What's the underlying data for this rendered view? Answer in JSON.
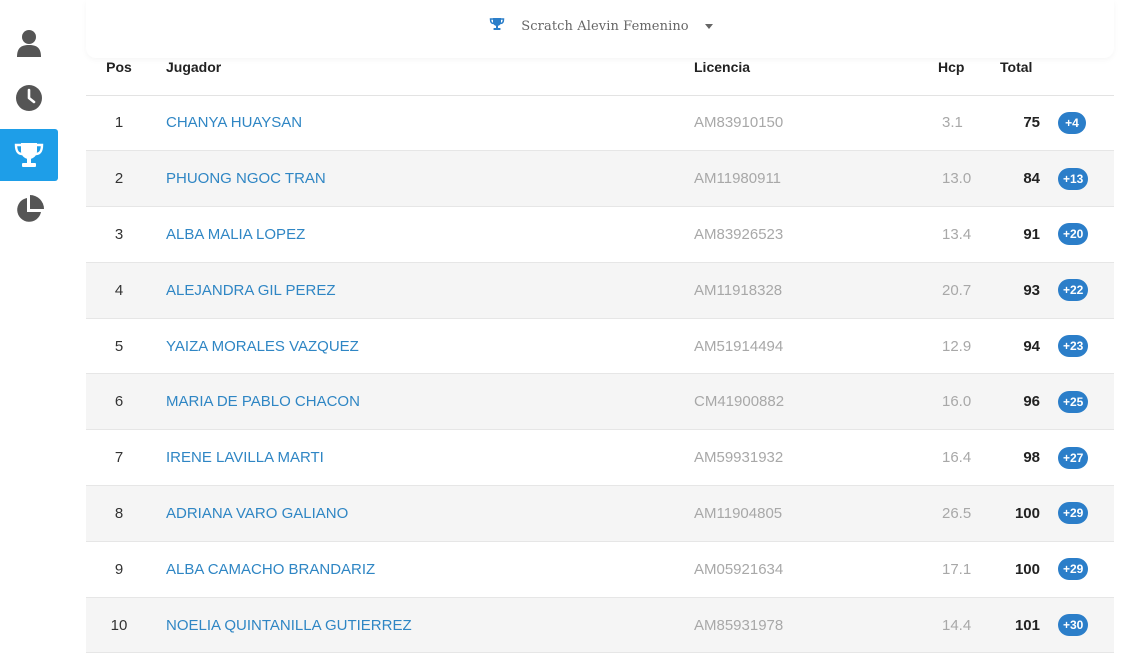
{
  "sidebar": {
    "items": [
      {
        "icon": "user-icon",
        "active": false
      },
      {
        "icon": "clock-icon",
        "active": false
      },
      {
        "icon": "trophy-icon",
        "active": true
      },
      {
        "icon": "pie-chart-icon",
        "active": false
      }
    ],
    "active_color": "#1e9ee8",
    "icon_color": "#555555"
  },
  "filter": {
    "icon": "trophy-icon",
    "selected": "Scratch Alevin Femenino"
  },
  "table": {
    "headers": {
      "pos": "Pos",
      "player": "Jugador",
      "license": "Licencia",
      "hcp": "Hcp",
      "total": "Total"
    },
    "rows": [
      {
        "pos": "1",
        "name": "CHANYA HUAYSAN",
        "license": "AM83910150",
        "hcp": "3.1",
        "total": "75",
        "diff": "+4"
      },
      {
        "pos": "2",
        "name": "PHUONG NGOC TRAN",
        "license": "AM11980911",
        "hcp": "13.0",
        "total": "84",
        "diff": "+13"
      },
      {
        "pos": "3",
        "name": "ALBA MALIA LOPEZ",
        "license": "AM83926523",
        "hcp": "13.4",
        "total": "91",
        "diff": "+20"
      },
      {
        "pos": "4",
        "name": "ALEJANDRA GIL PEREZ",
        "license": "AM11918328",
        "hcp": "20.7",
        "total": "93",
        "diff": "+22"
      },
      {
        "pos": "5",
        "name": "YAIZA MORALES VAZQUEZ",
        "license": "AM51914494",
        "hcp": "12.9",
        "total": "94",
        "diff": "+23"
      },
      {
        "pos": "6",
        "name": "MARIA DE PABLO CHACON",
        "license": "CM41900882",
        "hcp": "16.0",
        "total": "96",
        "diff": "+25"
      },
      {
        "pos": "7",
        "name": "IRENE LAVILLA MARTI",
        "license": "AM59931932",
        "hcp": "16.4",
        "total": "98",
        "diff": "+27"
      },
      {
        "pos": "8",
        "name": "ADRIANA VARO GALIANO",
        "license": "AM11904805",
        "hcp": "26.5",
        "total": "100",
        "diff": "+29"
      },
      {
        "pos": "9",
        "name": "ALBA CAMACHO BRANDARIZ",
        "license": "AM05921634",
        "hcp": "17.1",
        "total": "100",
        "diff": "+29"
      },
      {
        "pos": "10",
        "name": "NOELIA QUINTANILLA GUTIERREZ",
        "license": "AM85931978",
        "hcp": "14.4",
        "total": "101",
        "diff": "+30"
      }
    ],
    "link_color": "#2f86c4",
    "badge_color": "#2b7ec9"
  }
}
